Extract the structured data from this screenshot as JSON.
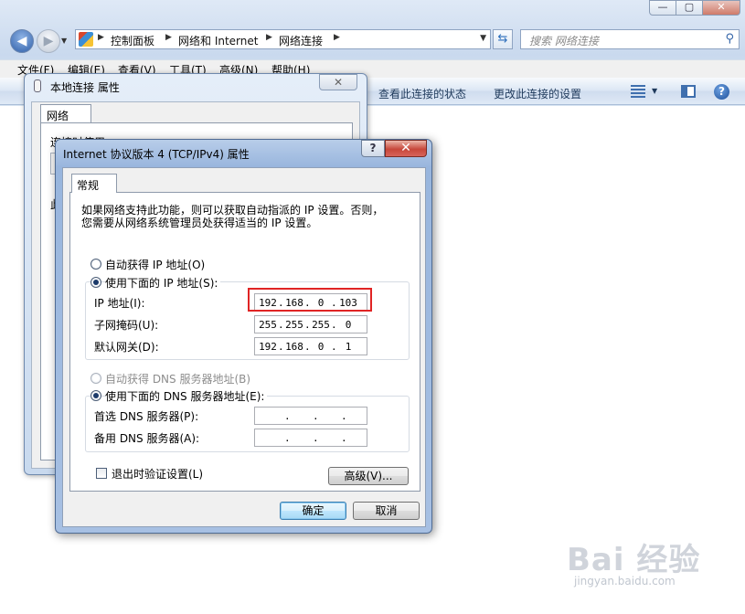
{
  "explorer": {
    "window_controls": {
      "minimize": "—",
      "maximize": "▢",
      "close": "✕"
    },
    "nav": {
      "back": "◀",
      "forward": "▶"
    },
    "breadcrumb": [
      "控制面板",
      "网络和 Internet",
      "网络连接"
    ],
    "search_placeholder": "搜索 网络连接",
    "menu": [
      "文件(F)",
      "编辑(E)",
      "查看(V)",
      "工具(T)",
      "高级(N)",
      "帮助(H)"
    ],
    "commands": [
      "查看此连接的状态",
      "更改此连接的设置"
    ]
  },
  "back_dialog": {
    "title": "本地连接 属性",
    "tab": "网络",
    "connect_using_label": "连接时使用:",
    "items_label": "此"
  },
  "ipv4_dialog": {
    "title": "Internet 协议版本 4 (TCP/IPv4) 属性",
    "help_button": "?",
    "close_button": "✕",
    "tab": "常规",
    "description": [
      "如果网络支持此功能，则可以获取自动指派的 IP 设置。否则，",
      "您需要从网络系统管理员处获得适当的 IP 设置。"
    ],
    "ip_section": {
      "auto_label": "自动获得 IP 地址(O)",
      "manual_label": "使用下面的 IP 地址(S):",
      "selected": "manual",
      "fields": [
        {
          "label": "IP 地址(I):",
          "octets": [
            "192",
            "168",
            "0",
            "103"
          ]
        },
        {
          "label": "子网掩码(U):",
          "octets": [
            "255",
            "255",
            "255",
            "0"
          ]
        },
        {
          "label": "默认网关(D):",
          "octets": [
            "192",
            "168",
            "0",
            "1"
          ]
        }
      ]
    },
    "dns_section": {
      "auto_label": "自动获得 DNS 服务器地址(B)",
      "manual_label": "使用下面的 DNS 服务器地址(E):",
      "selected": "manual",
      "fields": [
        {
          "label": "首选 DNS 服务器(P):",
          "octets": [
            "",
            "",
            "",
            ""
          ]
        },
        {
          "label": "备用 DNS 服务器(A):",
          "octets": [
            "",
            "",
            "",
            ""
          ]
        }
      ]
    },
    "validate_on_exit_label": "退出时验证设置(L)",
    "validate_on_exit_checked": false,
    "advanced_button": "高级(V)...",
    "ok_button": "确定",
    "cancel_button": "取消"
  },
  "watermark": {
    "logo": "Bai 经验",
    "url": "jingyan.baidu.com"
  },
  "colors": {
    "highlight_box": "#e02424",
    "dialog_frame": "#98b5dd"
  }
}
